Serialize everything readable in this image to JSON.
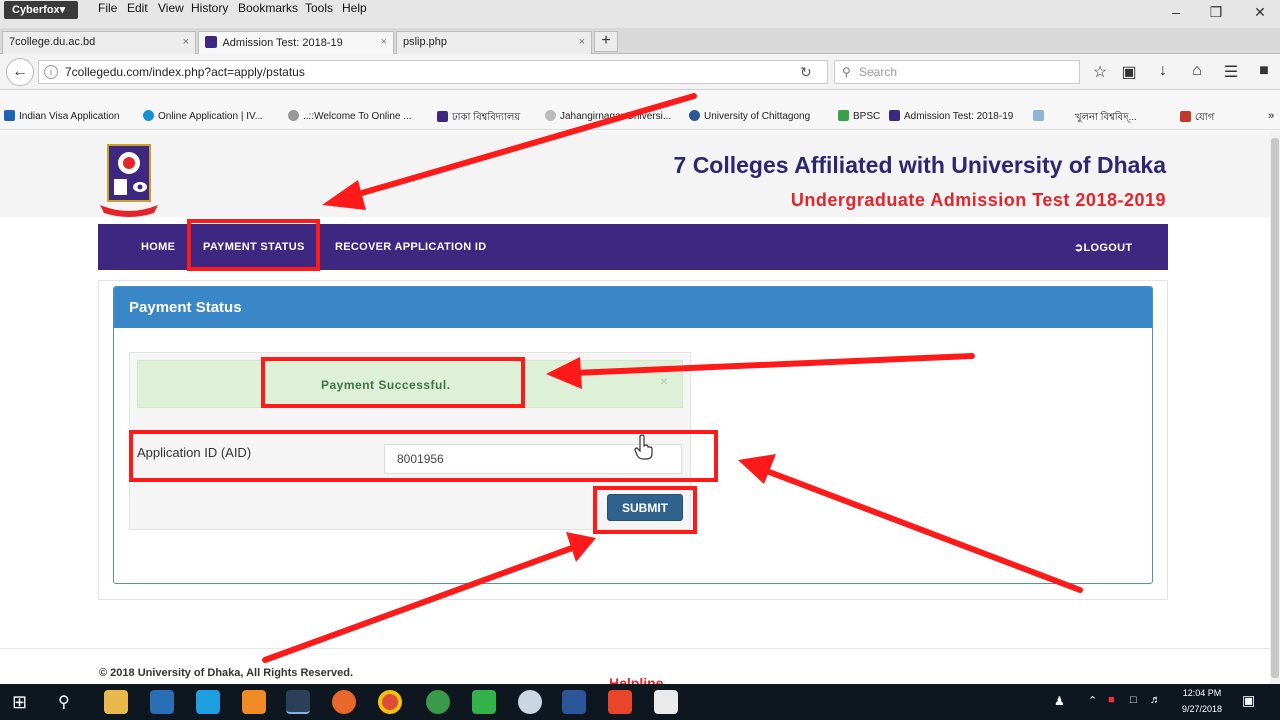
{
  "browser": {
    "brand": "Cyberfox▾",
    "menu": [
      "File",
      "Edit",
      "View",
      "History",
      "Bookmarks",
      "Tools",
      "Help"
    ],
    "tabs": [
      {
        "label": "7college.du.ac.bd"
      },
      {
        "label": "Admission Test: 2018-19"
      },
      {
        "label": "pslip.php"
      }
    ],
    "url": "7collegedu.com/index.php?act=apply/pstatus",
    "search_placeholder": "Search",
    "bookmarks": [
      "Indian Visa Application",
      "Online Application | IV...",
      "..::Welcome To Online ...",
      "ঢাকা বিশ্ববিদ্যালয়",
      "Jahangirnagar Universi...",
      "University of Chittagong",
      "BPSC",
      "Admission Test: 2018-19",
      "খুলনা বিশ্ববিদ্...",
      "যোগ"
    ]
  },
  "site": {
    "title": "7 Colleges Affiliated with University of Dhaka",
    "subtitle": "Undergraduate Admission Test 2018-2019",
    "colors": {
      "nav": "#3d2781",
      "title": "#2d2771",
      "subtitle": "#e5242a",
      "panel": "#3a87c7",
      "annotation": "#ff1a1a"
    },
    "nav": {
      "home": "HOME",
      "payment_status": "PAYMENT STATUS",
      "recover": "RECOVER APPLICATION ID",
      "logout": "LOGOUT"
    }
  },
  "panel": {
    "title": "Payment Status",
    "alert": "Payment Successful.",
    "alert_close": "×",
    "aid_label": "Application ID (AID)",
    "aid_value": "8001956",
    "submit": "SUBMIT"
  },
  "footer": {
    "copyright": "© 2018 University of Dhaka, All Rights Reserved.",
    "helpline": "Helpline"
  },
  "taskbar": {
    "time": "12:04 PM",
    "date": "9/27/2018"
  }
}
